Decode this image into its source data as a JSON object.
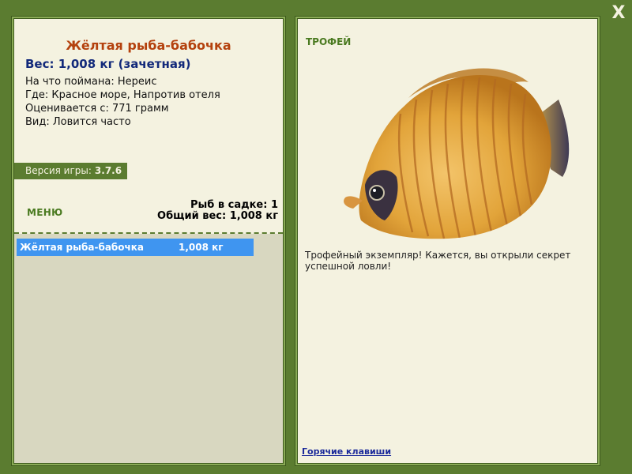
{
  "fish": {
    "title": "Жёлтая рыба-бабочка",
    "weight_line": "Вес: 1,008 кг (зачетная)",
    "bait_line": "На что поймана: Нереис",
    "place_line": "Где: Красное море, Напротив отеля",
    "price_line": "Оценивается с: 771 грамм",
    "kind_line": "Вид: Ловится часто"
  },
  "version": {
    "label": "Версия игры:",
    "value": "3.7.6"
  },
  "menu": {
    "label": "МЕНЮ"
  },
  "keepnet": {
    "count_line": "Рыб в садке: 1",
    "total_line": "Общий вес: 1,008 кг",
    "items": [
      {
        "name": "Жёлтая рыба-бабочка",
        "weight": "1,008 кг"
      }
    ]
  },
  "trophy": {
    "label": "ТРОФЕЙ",
    "text": "Трофейный экземпляр! Кажется, вы открыли секрет успешной ловли!"
  },
  "hotkeys": {
    "label": "Горячие клавиши"
  },
  "close": {
    "label": "X"
  },
  "colors": {
    "frame": "#5b7c30",
    "panel": "#f4f2e0",
    "title": "#b4410d",
    "weight": "#12297a",
    "selection": "#3f95f0"
  }
}
